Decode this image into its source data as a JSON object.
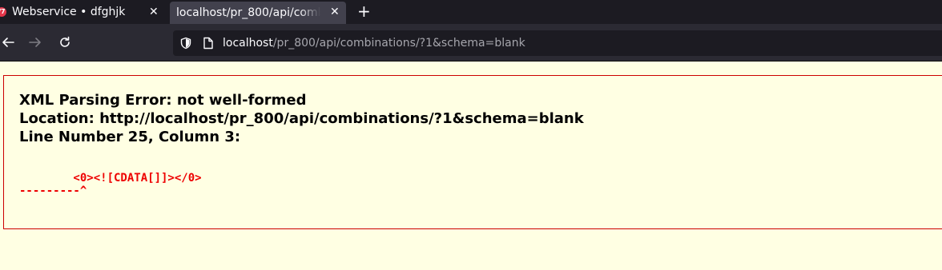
{
  "tabs": [
    {
      "title": "Webservice • dfghjk",
      "favicon": "prestashop-icon",
      "favicon_text": "f7",
      "active": false
    },
    {
      "title": "localhost/pr_800/api/combinations/?1&schema=blank",
      "active": true
    }
  ],
  "tab_close_glyph": "✕",
  "new_tab_glyph": "+",
  "urlbar": {
    "host": "localhost",
    "path": "/pr_800/api/combinations/?1&schema=blank"
  },
  "error": {
    "title_line": "XML Parsing Error: not well-formed",
    "location_line": "Location: http://localhost/pr_800/api/combinations/?1&schema=blank",
    "line_number_line": "Line Number 25, Column 3:",
    "source_line": "        <0><![CDATA[]]></0>",
    "pointer_line": "---------^"
  },
  "colors": {
    "tabstrip": "#1c1b22",
    "active_tab": "#42414d",
    "navbar": "#2b2a33",
    "page_background": "#ffffe3",
    "error_border": "#cc0000",
    "source_text": "#ee0000"
  }
}
